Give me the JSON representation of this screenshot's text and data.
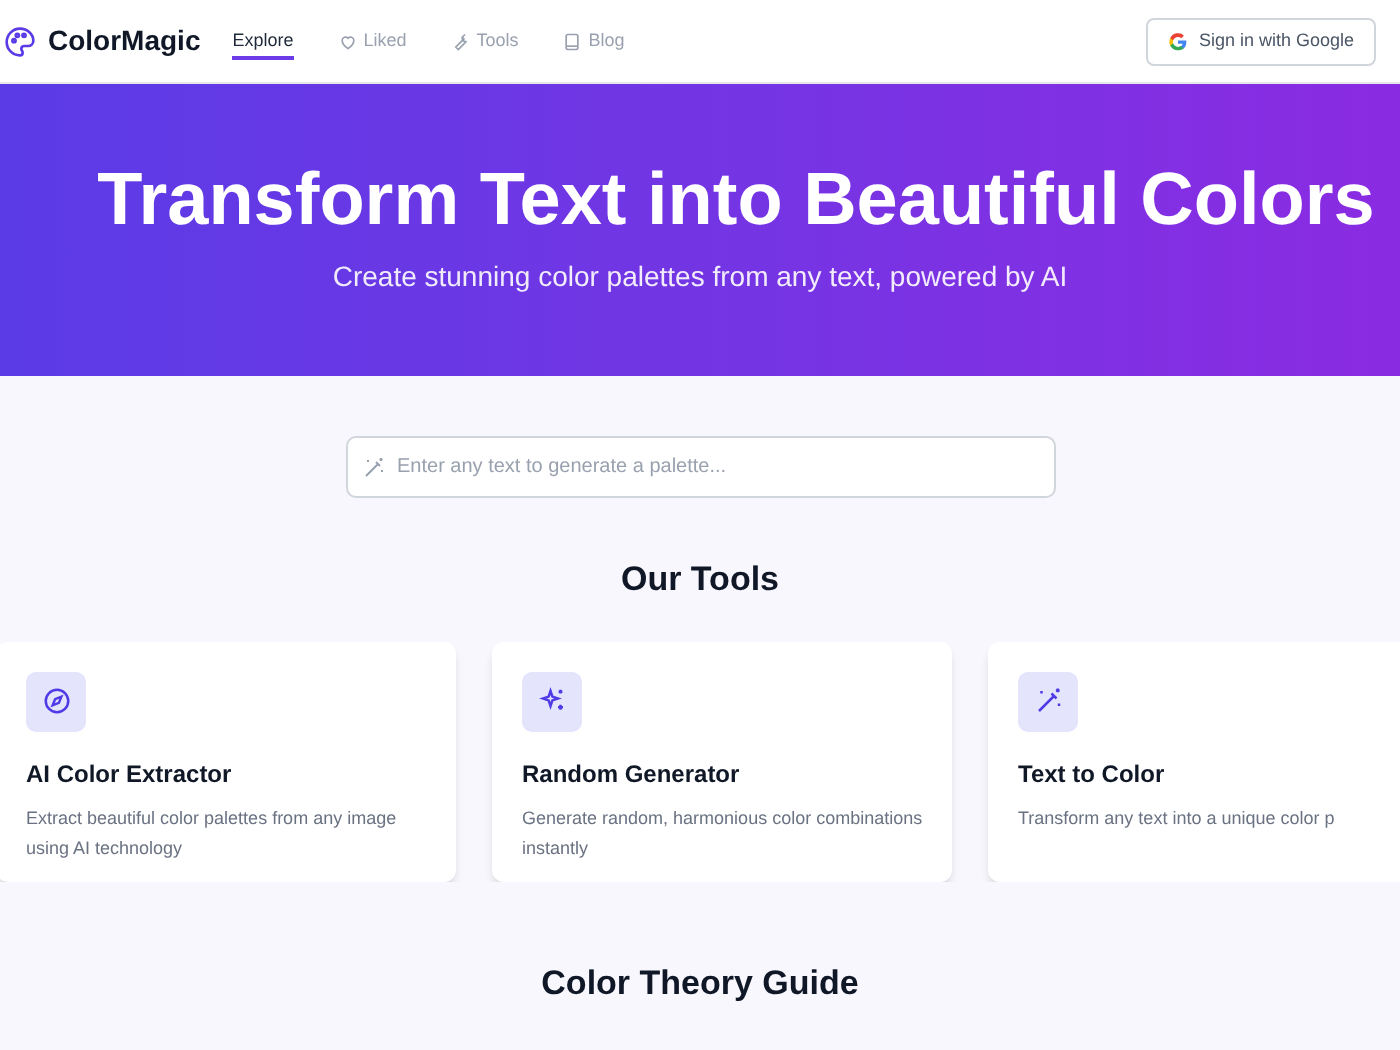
{
  "brand": "ColorMagic",
  "nav": [
    {
      "label": "Explore",
      "selected": true
    },
    {
      "label": "Liked",
      "selected": false
    },
    {
      "label": "Tools",
      "selected": false
    },
    {
      "label": "Blog",
      "selected": false
    }
  ],
  "sign_in": "Sign in with Google",
  "hero": {
    "title": "Transform Text into Beautiful Colors",
    "subtitle": "Create stunning color palettes from any text, powered by AI"
  },
  "search": {
    "placeholder": "Enter any text to generate a palette..."
  },
  "tools_heading": "Our Tools",
  "tools": [
    {
      "title": "AI Color Extractor",
      "description": "Extract beautiful color palettes from any image using AI technology"
    },
    {
      "title": "Random Generator",
      "description": "Generate random, harmonious color combinations instantly"
    },
    {
      "title": "Text to Color",
      "description": "Transform any text into a unique color p"
    }
  ],
  "guide_heading": "Color Theory Guide"
}
